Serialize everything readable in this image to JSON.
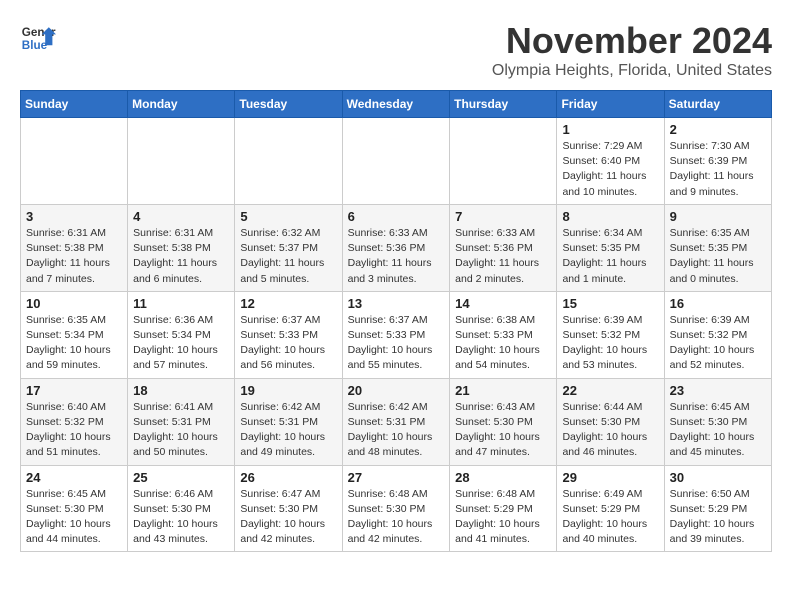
{
  "header": {
    "logo_line1": "General",
    "logo_line2": "Blue",
    "month_title": "November 2024",
    "location": "Olympia Heights, Florida, United States"
  },
  "days_of_week": [
    "Sunday",
    "Monday",
    "Tuesday",
    "Wednesday",
    "Thursday",
    "Friday",
    "Saturday"
  ],
  "weeks": [
    [
      {
        "day": "",
        "info": ""
      },
      {
        "day": "",
        "info": ""
      },
      {
        "day": "",
        "info": ""
      },
      {
        "day": "",
        "info": ""
      },
      {
        "day": "",
        "info": ""
      },
      {
        "day": "1",
        "info": "Sunrise: 7:29 AM\nSunset: 6:40 PM\nDaylight: 11 hours and 10 minutes."
      },
      {
        "day": "2",
        "info": "Sunrise: 7:30 AM\nSunset: 6:39 PM\nDaylight: 11 hours and 9 minutes."
      }
    ],
    [
      {
        "day": "3",
        "info": "Sunrise: 6:31 AM\nSunset: 5:38 PM\nDaylight: 11 hours and 7 minutes."
      },
      {
        "day": "4",
        "info": "Sunrise: 6:31 AM\nSunset: 5:38 PM\nDaylight: 11 hours and 6 minutes."
      },
      {
        "day": "5",
        "info": "Sunrise: 6:32 AM\nSunset: 5:37 PM\nDaylight: 11 hours and 5 minutes."
      },
      {
        "day": "6",
        "info": "Sunrise: 6:33 AM\nSunset: 5:36 PM\nDaylight: 11 hours and 3 minutes."
      },
      {
        "day": "7",
        "info": "Sunrise: 6:33 AM\nSunset: 5:36 PM\nDaylight: 11 hours and 2 minutes."
      },
      {
        "day": "8",
        "info": "Sunrise: 6:34 AM\nSunset: 5:35 PM\nDaylight: 11 hours and 1 minute."
      },
      {
        "day": "9",
        "info": "Sunrise: 6:35 AM\nSunset: 5:35 PM\nDaylight: 11 hours and 0 minutes."
      }
    ],
    [
      {
        "day": "10",
        "info": "Sunrise: 6:35 AM\nSunset: 5:34 PM\nDaylight: 10 hours and 59 minutes."
      },
      {
        "day": "11",
        "info": "Sunrise: 6:36 AM\nSunset: 5:34 PM\nDaylight: 10 hours and 57 minutes."
      },
      {
        "day": "12",
        "info": "Sunrise: 6:37 AM\nSunset: 5:33 PM\nDaylight: 10 hours and 56 minutes."
      },
      {
        "day": "13",
        "info": "Sunrise: 6:37 AM\nSunset: 5:33 PM\nDaylight: 10 hours and 55 minutes."
      },
      {
        "day": "14",
        "info": "Sunrise: 6:38 AM\nSunset: 5:33 PM\nDaylight: 10 hours and 54 minutes."
      },
      {
        "day": "15",
        "info": "Sunrise: 6:39 AM\nSunset: 5:32 PM\nDaylight: 10 hours and 53 minutes."
      },
      {
        "day": "16",
        "info": "Sunrise: 6:39 AM\nSunset: 5:32 PM\nDaylight: 10 hours and 52 minutes."
      }
    ],
    [
      {
        "day": "17",
        "info": "Sunrise: 6:40 AM\nSunset: 5:32 PM\nDaylight: 10 hours and 51 minutes."
      },
      {
        "day": "18",
        "info": "Sunrise: 6:41 AM\nSunset: 5:31 PM\nDaylight: 10 hours and 50 minutes."
      },
      {
        "day": "19",
        "info": "Sunrise: 6:42 AM\nSunset: 5:31 PM\nDaylight: 10 hours and 49 minutes."
      },
      {
        "day": "20",
        "info": "Sunrise: 6:42 AM\nSunset: 5:31 PM\nDaylight: 10 hours and 48 minutes."
      },
      {
        "day": "21",
        "info": "Sunrise: 6:43 AM\nSunset: 5:30 PM\nDaylight: 10 hours and 47 minutes."
      },
      {
        "day": "22",
        "info": "Sunrise: 6:44 AM\nSunset: 5:30 PM\nDaylight: 10 hours and 46 minutes."
      },
      {
        "day": "23",
        "info": "Sunrise: 6:45 AM\nSunset: 5:30 PM\nDaylight: 10 hours and 45 minutes."
      }
    ],
    [
      {
        "day": "24",
        "info": "Sunrise: 6:45 AM\nSunset: 5:30 PM\nDaylight: 10 hours and 44 minutes."
      },
      {
        "day": "25",
        "info": "Sunrise: 6:46 AM\nSunset: 5:30 PM\nDaylight: 10 hours and 43 minutes."
      },
      {
        "day": "26",
        "info": "Sunrise: 6:47 AM\nSunset: 5:30 PM\nDaylight: 10 hours and 42 minutes."
      },
      {
        "day": "27",
        "info": "Sunrise: 6:48 AM\nSunset: 5:30 PM\nDaylight: 10 hours and 42 minutes."
      },
      {
        "day": "28",
        "info": "Sunrise: 6:48 AM\nSunset: 5:29 PM\nDaylight: 10 hours and 41 minutes."
      },
      {
        "day": "29",
        "info": "Sunrise: 6:49 AM\nSunset: 5:29 PM\nDaylight: 10 hours and 40 minutes."
      },
      {
        "day": "30",
        "info": "Sunrise: 6:50 AM\nSunset: 5:29 PM\nDaylight: 10 hours and 39 minutes."
      }
    ]
  ]
}
